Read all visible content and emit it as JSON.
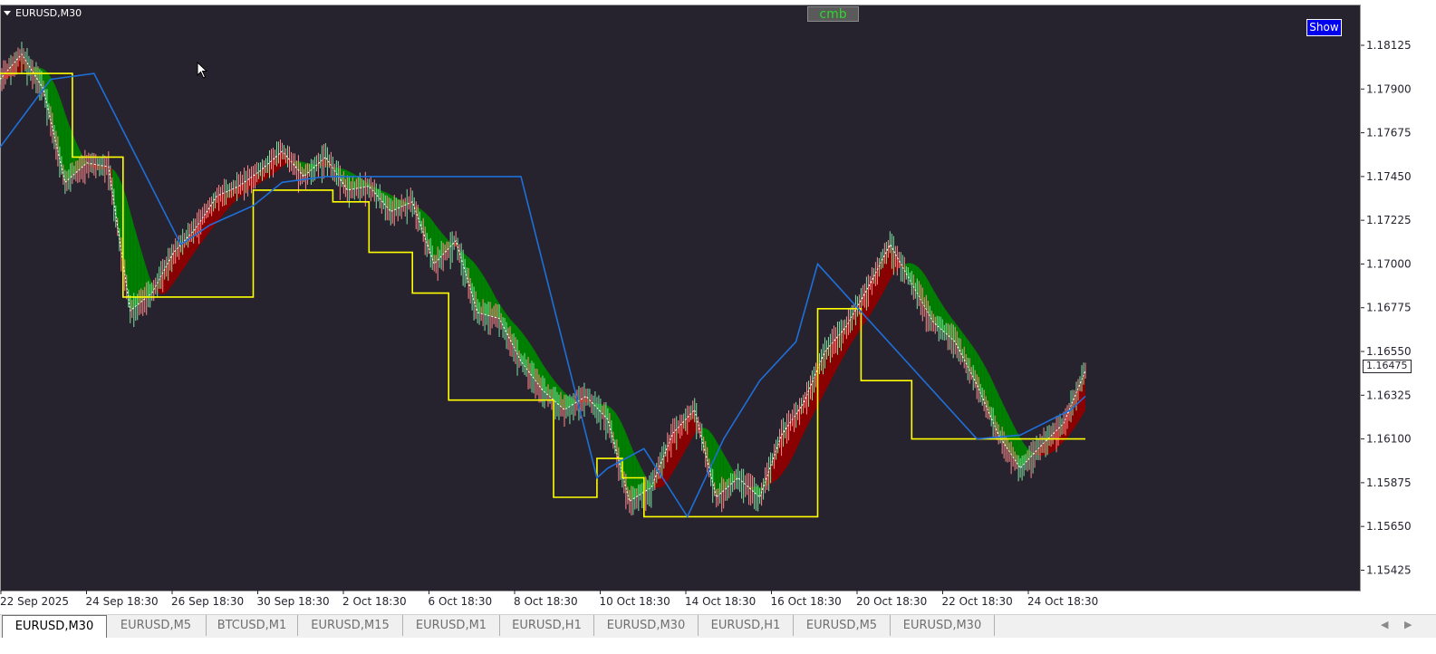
{
  "window": {
    "symbol_label": "EURUSD,M30"
  },
  "indicator": {
    "cmb_label": "cmb",
    "show_label": "Show"
  },
  "tabs": [
    {
      "label": "EURUSD,M30",
      "active": true
    },
    {
      "label": "EURUSD,M5",
      "active": false
    },
    {
      "label": "BTCUSD,M1",
      "active": false
    },
    {
      "label": "EURUSD,M15",
      "active": false
    },
    {
      "label": "EURUSD,M1",
      "active": false
    },
    {
      "label": "EURUSD,H1",
      "active": false
    },
    {
      "label": "EURUSD,M30",
      "active": false
    },
    {
      "label": "EURUSD,H1",
      "active": false
    },
    {
      "label": "EURUSD,M5",
      "active": false
    },
    {
      "label": "EURUSD,M30",
      "active": false
    }
  ],
  "colors": {
    "background": "#27232e",
    "bull_candle": "#7fe0a0",
    "bear_candle": "#ff8a8a",
    "fill_up": "#8b0000",
    "fill_down": "#008000",
    "resistance_line": "#ffff00",
    "support_line": "#1e6fd9",
    "axis_text": "#ffffff"
  },
  "chart_data": {
    "type": "line",
    "symbol": "EURUSD",
    "timeframe": "M30",
    "current_price": "1.16475",
    "x_tick_labels": [
      "22 Sep 2025",
      "24 Sep 18:30",
      "26 Sep 18:30",
      "30 Sep 18:30",
      "2 Oct 18:30",
      "6 Oct 18:30",
      "8 Oct 18:30",
      "10 Oct 18:30",
      "14 Oct 18:30",
      "16 Oct 18:30",
      "20 Oct 18:30",
      "22 Oct 18:30",
      "24 Oct 18:30"
    ],
    "y_tick_labels": [
      "1.18125",
      "1.17900",
      "1.17675",
      "1.17450",
      "1.17225",
      "1.17000",
      "1.16775",
      "1.16550",
      "1.16325",
      "1.16100",
      "1.15875",
      "1.15650",
      "1.15425"
    ],
    "ylim": [
      1.1532,
      1.1833
    ],
    "price_series": {
      "x_index": [
        0,
        6,
        12,
        18,
        24,
        30,
        36,
        42,
        48,
        54,
        60,
        66,
        72,
        78,
        84,
        90,
        96,
        102,
        108,
        114,
        120,
        126,
        132,
        138,
        144,
        150,
        156,
        162,
        168,
        174,
        180,
        186,
        192,
        198,
        204,
        210,
        216,
        222,
        228,
        234,
        240,
        246,
        252,
        258,
        264,
        270,
        276,
        282,
        288,
        294,
        300
      ],
      "close": [
        1.1795,
        1.1808,
        1.179,
        1.1742,
        1.1752,
        1.175,
        1.1676,
        1.1685,
        1.1706,
        1.1718,
        1.1735,
        1.174,
        1.1748,
        1.1758,
        1.1745,
        1.1755,
        1.1738,
        1.174,
        1.1727,
        1.1732,
        1.17,
        1.1712,
        1.1675,
        1.1672,
        1.165,
        1.1635,
        1.1625,
        1.1632,
        1.162,
        1.1578,
        1.1585,
        1.1613,
        1.1625,
        1.158,
        1.159,
        1.158,
        1.1612,
        1.1628,
        1.1655,
        1.1668,
        1.1688,
        1.171,
        1.169,
        1.167,
        1.166,
        1.1638,
        1.1612,
        1.1595,
        1.1607,
        1.1618,
        1.1645
      ]
    },
    "resistance_line": {
      "x_index": [
        0,
        20,
        20,
        34,
        34,
        39,
        39,
        70,
        70,
        92,
        92,
        102,
        102,
        114,
        114,
        124,
        124,
        153,
        153,
        165,
        165,
        172,
        172,
        178,
        178,
        183,
        183,
        226,
        226,
        238,
        238,
        252,
        252,
        272,
        272,
        300
      ],
      "y": [
        1.1798,
        1.1798,
        1.1755,
        1.1755,
        1.1683,
        1.1683,
        1.1683,
        1.1683,
        1.1738,
        1.1738,
        1.1732,
        1.1732,
        1.1706,
        1.1706,
        1.1685,
        1.1685,
        1.163,
        1.163,
        1.158,
        1.158,
        1.16,
        1.16,
        1.159,
        1.159,
        1.157,
        1.157,
        1.157,
        1.157,
        1.1677,
        1.1677,
        1.164,
        1.164,
        1.161,
        1.161,
        1.161,
        1.161
      ]
    },
    "support_line": {
      "x_index": [
        0,
        14,
        14,
        26,
        26,
        50,
        50,
        58,
        58,
        70,
        70,
        78,
        78,
        90,
        90,
        120,
        120,
        144,
        144,
        165,
        165,
        168,
        168,
        178,
        178,
        190,
        190,
        200,
        200,
        210,
        210,
        220,
        220,
        226,
        226,
        270,
        270,
        282,
        282,
        296,
        296,
        300
      ],
      "y": [
        1.176,
        1.1795,
        1.1795,
        1.1798,
        1.1798,
        1.171,
        1.171,
        1.172,
        1.172,
        1.173,
        1.173,
        1.1742,
        1.1742,
        1.1745,
        1.1745,
        1.1745,
        1.1745,
        1.1745,
        1.1745,
        1.159,
        1.159,
        1.1595,
        1.1595,
        1.1605,
        1.1605,
        1.157,
        1.157,
        1.161,
        1.161,
        1.164,
        1.164,
        1.166,
        1.166,
        1.17,
        1.17,
        1.161,
        1.161,
        1.1612,
        1.1612,
        1.1625,
        1.1625,
        1.1632
      ]
    }
  }
}
